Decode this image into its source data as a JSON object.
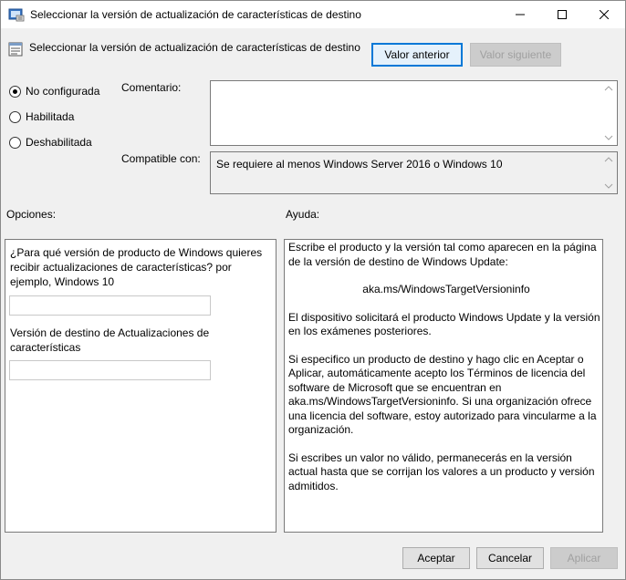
{
  "window": {
    "title": "Seleccionar la versión de actualización de características de destino"
  },
  "header": {
    "title": "Seleccionar la versión de actualización de características de destino",
    "prev_button": "Valor anterior",
    "next_button": "Valor siguiente"
  },
  "state": {
    "options": [
      {
        "label": "No configurada",
        "checked": true
      },
      {
        "label": "Habilitada",
        "checked": false
      },
      {
        "label": "Deshabilitada",
        "checked": false
      }
    ]
  },
  "comment": {
    "label": "Comentario:",
    "value": ""
  },
  "compatible": {
    "label": "Compatible con:",
    "value": "Se requiere al menos Windows Server 2016 o Windows 10"
  },
  "options_panel": {
    "label": "Opciones:",
    "field1_label": "¿Para qué versión de producto de Windows quieres recibir actualizaciones de características? por ejemplo, Windows 10",
    "field1_value": "",
    "field2_label": "Versión de destino de Actualizaciones de características",
    "field2_value": ""
  },
  "help_panel": {
    "label": "Ayuda:",
    "paragraphs": [
      "Escribe el producto y la versión tal como aparecen en la página de la versión de destino de Windows Update:",
      "aka.ms/WindowsTargetVersioninfo",
      "El dispositivo solicitará el producto Windows Update y la versión en los exámenes posteriores.",
      "Si especifico un producto de destino y hago clic en Aceptar o Aplicar, automáticamente acepto los Términos de licencia del software de Microsoft que se encuentran en aka.ms/WindowsTargetVersioninfo. Si una organización ofrece una licencia del software, estoy autorizado para vincularme a la organización.",
      "Si escribes un valor no válido, permanecerás en la versión actual hasta que se corrijan los valores a un producto y versión admitidos."
    ]
  },
  "footer": {
    "ok_button": "Aceptar",
    "cancel_button": "Cancelar",
    "apply_button": "Aplicar"
  },
  "colors": {
    "focus_border": "#0078d7",
    "window_bg": "#f0f0f0"
  }
}
